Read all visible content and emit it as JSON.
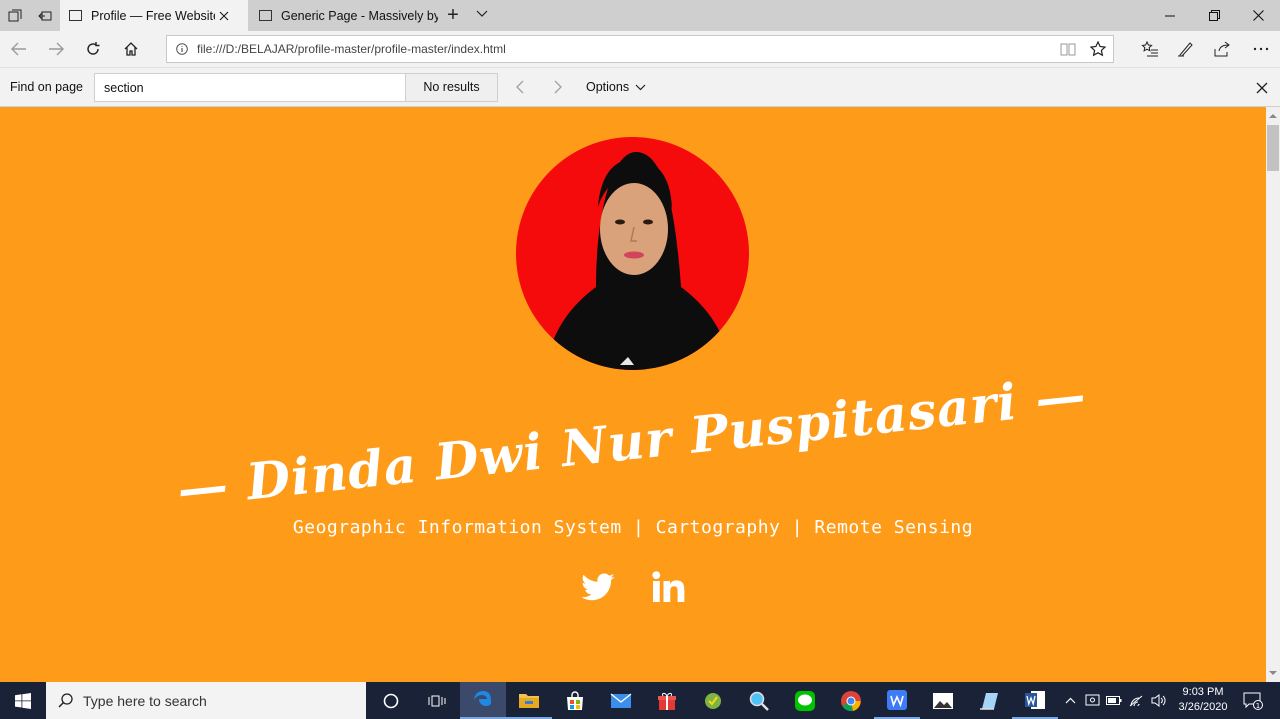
{
  "browser": {
    "tabs": [
      {
        "title": "Profile — Free Website T",
        "active": true
      },
      {
        "title": "Generic Page - Massively by",
        "active": false
      }
    ],
    "url": "file:///D:/BELAJAR/profile-master/profile-master/index.html"
  },
  "find_bar": {
    "label": "Find on page",
    "query": "section",
    "results": "No results",
    "options_label": "Options"
  },
  "profile": {
    "name": "— Dinda Dwi Nur Puspitasari —",
    "tagline": "Geographic Information System | Cartography | Remote Sensing",
    "social_icons": [
      "twitter-icon",
      "linkedin-icon"
    ]
  },
  "colors": {
    "page_background": "#fe9c1a",
    "avatar_background": "#f50b0b",
    "text": "#ffffff"
  },
  "taskbar": {
    "search_placeholder": "Type here to search",
    "time": "9:03 PM",
    "date": "3/26/2020",
    "notification_count": "1"
  }
}
